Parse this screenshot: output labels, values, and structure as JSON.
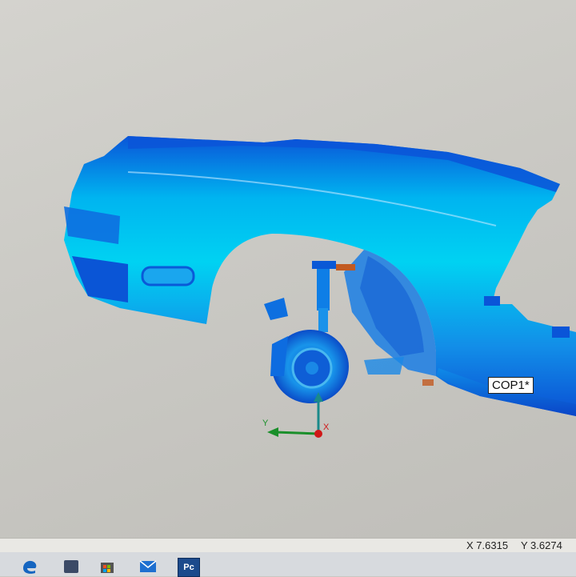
{
  "viewport": {
    "label_tag": "COP1*",
    "axes": {
      "x": "X",
      "y": "Y"
    }
  },
  "statusbar": {
    "x_coord": "X 7.6315",
    "y_coord": "Y 3.6274"
  },
  "taskbar": {
    "pinned": [
      {
        "icon": "edge-icon"
      },
      {
        "icon": "store-icon"
      },
      {
        "icon": "mail-icon"
      },
      {
        "icon": "polyworks-icon",
        "text": "Pc"
      }
    ]
  },
  "colors": {
    "scan_bright": "#00c8f0",
    "scan_mid": "#1a9bea",
    "scan_dark": "#0a4fd6",
    "axis_x": "#d01818",
    "axis_y": "#1a8f2a",
    "axis_z": "#1a8a8a"
  }
}
